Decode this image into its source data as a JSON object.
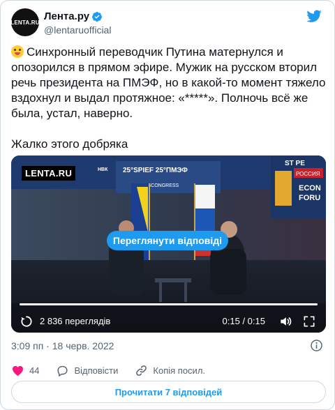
{
  "account": {
    "display_name": "Лента.ру",
    "handle": "@lentaruofficial",
    "avatar_text": "LENTA.RU",
    "avatar_color": "#111111",
    "verified_icon": "verified-badge-icon"
  },
  "brand": {
    "logo_icon": "twitter-bird-icon",
    "accent_color": "#1d9bf0"
  },
  "tweet": {
    "emoji_icon": "zany-face-emoji",
    "text": "Синхронный переводчик Путина матернулся и опозорился в прямом эфире. Мужик на русском вторил речь президента на ПМЭФ, но в какой-то момент тяжело вздохнул и выдал протяжное: «*****». Полночь всё же была, устал, наверно.\n\nЖалко этого добряка"
  },
  "media": {
    "watermark": "LENTA.RU",
    "replay_button_label": "Переглянути відповіді",
    "views": "2 836 переглядів",
    "timecode": "0:15 / 0:15",
    "progress": 1.0,
    "scene_texts": {
      "event_banner": "25°SPIEF 25°ПМЭФ",
      "roscongress": "ROSCONGRESS",
      "right_banner_top": "ST PE",
      "right_banner_mid": "РОССИЯ",
      "right_banner_econ": "ECON",
      "right_banner_forum": "FORU",
      "left_banner": "НВК"
    }
  },
  "meta": {
    "time": "3:09 пп",
    "separator": "·",
    "date": "18 черв. 2022"
  },
  "actions": {
    "likes_count": "44",
    "reply_label": "Відповісти",
    "copy_link_label": "Копія посил."
  },
  "cta": {
    "label": "Прочитати 7 відповідей"
  }
}
